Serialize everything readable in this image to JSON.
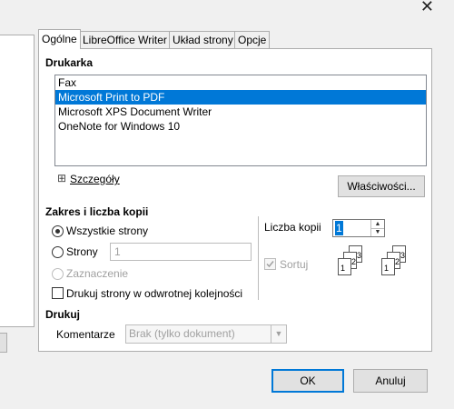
{
  "window": {
    "close_glyph": "✕"
  },
  "tabs": [
    {
      "label": "Ogólne",
      "active": true
    },
    {
      "label": "LibreOffice Writer",
      "active": false
    },
    {
      "label": "Układ strony",
      "active": false
    },
    {
      "label": "Opcje",
      "active": false
    }
  ],
  "printer": {
    "title": "Drukarka",
    "items": [
      "Fax",
      "Microsoft Print to PDF",
      "Microsoft XPS Document Writer",
      "OneNote for Windows 10"
    ],
    "selected": "Microsoft Print to PDF",
    "details_label": "Szczegóły",
    "details_expander": "⊞",
    "properties_button": "Właściwości..."
  },
  "range": {
    "title": "Zakres i liczba kopii",
    "all_pages": "Wszystkie strony",
    "pages": "Strony",
    "pages_value": "1",
    "selection": "Zaznaczenie",
    "reverse_order": "Drukuj strony w odwrotnej kolejności",
    "copies_label": "Liczba kopii",
    "copies_value": "1",
    "collate_label": "Sortuj"
  },
  "print": {
    "title": "Drukuj",
    "comments_label": "Komentarze",
    "comments_value": "Brak (tylko dokument)"
  },
  "buttons": {
    "ok": "OK",
    "cancel": "Anuluj"
  },
  "colors": {
    "selection": "#0078d7",
    "border": "#adadad",
    "disabled": "#a0a0a0"
  }
}
